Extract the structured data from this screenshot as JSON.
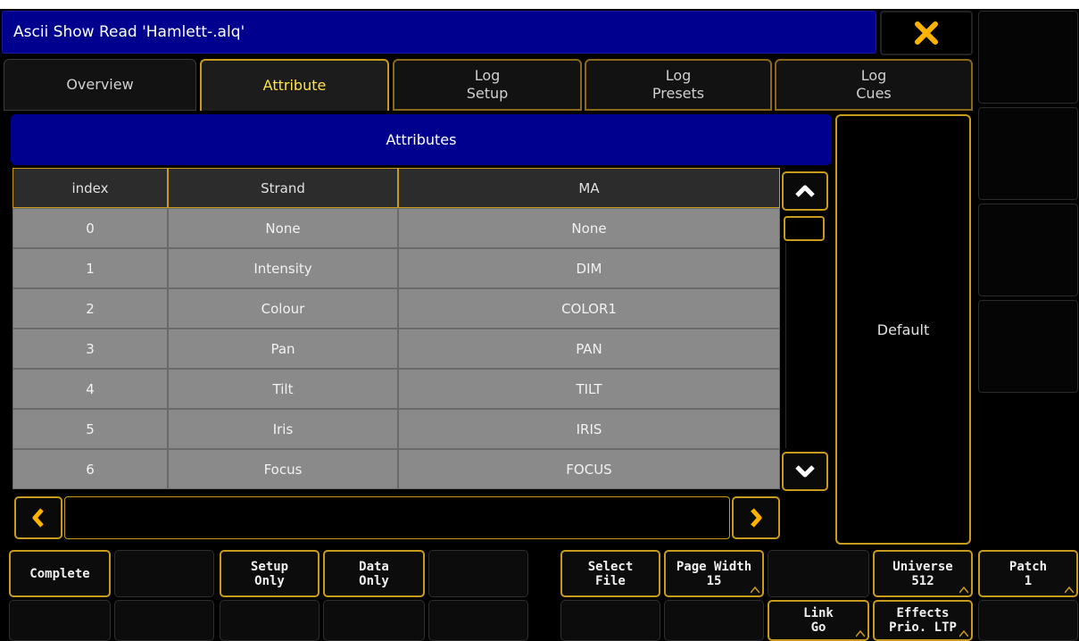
{
  "window": {
    "title": "Ascii Show Read 'Hamlett-.alq'"
  },
  "colors": {
    "accent": "#c89a1e",
    "header_blue": "#00008f",
    "active_tab_text": "#ffe14d",
    "close_icon": "#ffb300"
  },
  "tabs": [
    {
      "line1": "Overview",
      "line2": ""
    },
    {
      "line1": "Attribute",
      "line2": ""
    },
    {
      "line1": "Log",
      "line2": "Setup"
    },
    {
      "line1": "Log",
      "line2": "Presets"
    },
    {
      "line1": "Log",
      "line2": "Cues"
    }
  ],
  "section": {
    "title": "Attributes"
  },
  "table": {
    "columns": [
      "index",
      "Strand",
      "MA"
    ],
    "rows": [
      [
        "0",
        "None",
        "None"
      ],
      [
        "1",
        "Intensity",
        "DIM"
      ],
      [
        "2",
        "Colour",
        "COLOR1"
      ],
      [
        "3",
        "Pan",
        "PAN"
      ],
      [
        "4",
        "Tilt",
        "TILT"
      ],
      [
        "5",
        "Iris",
        "IRIS"
      ],
      [
        "6",
        "Focus",
        "FOCUS"
      ]
    ]
  },
  "side_panel": {
    "label": "Default"
  },
  "softkeys": {
    "row1": [
      {
        "line1": "Complete",
        "line2": ""
      },
      {
        "line1": "",
        "line2": ""
      },
      {
        "line1": "Setup",
        "line2": "Only"
      },
      {
        "line1": "Data",
        "line2": "Only"
      },
      {
        "line1": "",
        "line2": ""
      },
      {
        "line1": "Select",
        "line2": "File"
      },
      {
        "line1": "Page Width",
        "line2": "15"
      },
      {
        "line1": "",
        "line2": ""
      },
      {
        "line1": "Universe",
        "line2": "512"
      },
      {
        "line1": "Patch",
        "line2": "1"
      }
    ],
    "row2": [
      {
        "line1": "",
        "line2": ""
      },
      {
        "line1": "",
        "line2": ""
      },
      {
        "line1": "",
        "line2": ""
      },
      {
        "line1": "",
        "line2": ""
      },
      {
        "line1": "",
        "line2": ""
      },
      {
        "line1": "",
        "line2": ""
      },
      {
        "line1": "",
        "line2": ""
      },
      {
        "line1": "Link",
        "line2": "Go"
      },
      {
        "line1": "Effects",
        "line2": "Prio. LTP"
      },
      {
        "line1": "",
        "line2": ""
      }
    ]
  }
}
